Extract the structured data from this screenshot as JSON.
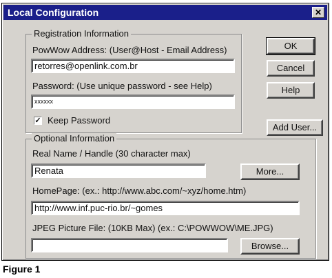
{
  "window": {
    "title": "Local Configuration",
    "close_glyph": "✕"
  },
  "registration": {
    "group_label": "Registration Information",
    "address_label": "PowWow Address: (User@Host - Email Address)",
    "address_value": "retorres@openlink.com.br",
    "password_label": "Password: (Use unique password - see Help)",
    "password_value": "xxxxxx",
    "keep_password_label": "Keep Password",
    "keep_password_checked": true,
    "check_glyph": "✓"
  },
  "optional": {
    "group_label": "Optional Information",
    "name_label": "Real Name / Handle (30 character max)",
    "name_value": "Renata",
    "homepage_label": "HomePage: (ex.: http://www.abc.com/~xyz/home.htm)",
    "homepage_value": "http://www.inf.puc-rio.br/~gomes",
    "jpeg_label": "JPEG Picture File: (10KB Max) (ex.: C:\\POWWOW\\ME.JPG)",
    "jpeg_value": ""
  },
  "buttons": {
    "ok": "OK",
    "cancel": "Cancel",
    "help": "Help",
    "add_user": "Add User...",
    "more": "More...",
    "browse": "Browse..."
  },
  "caption": "Figure 1"
}
